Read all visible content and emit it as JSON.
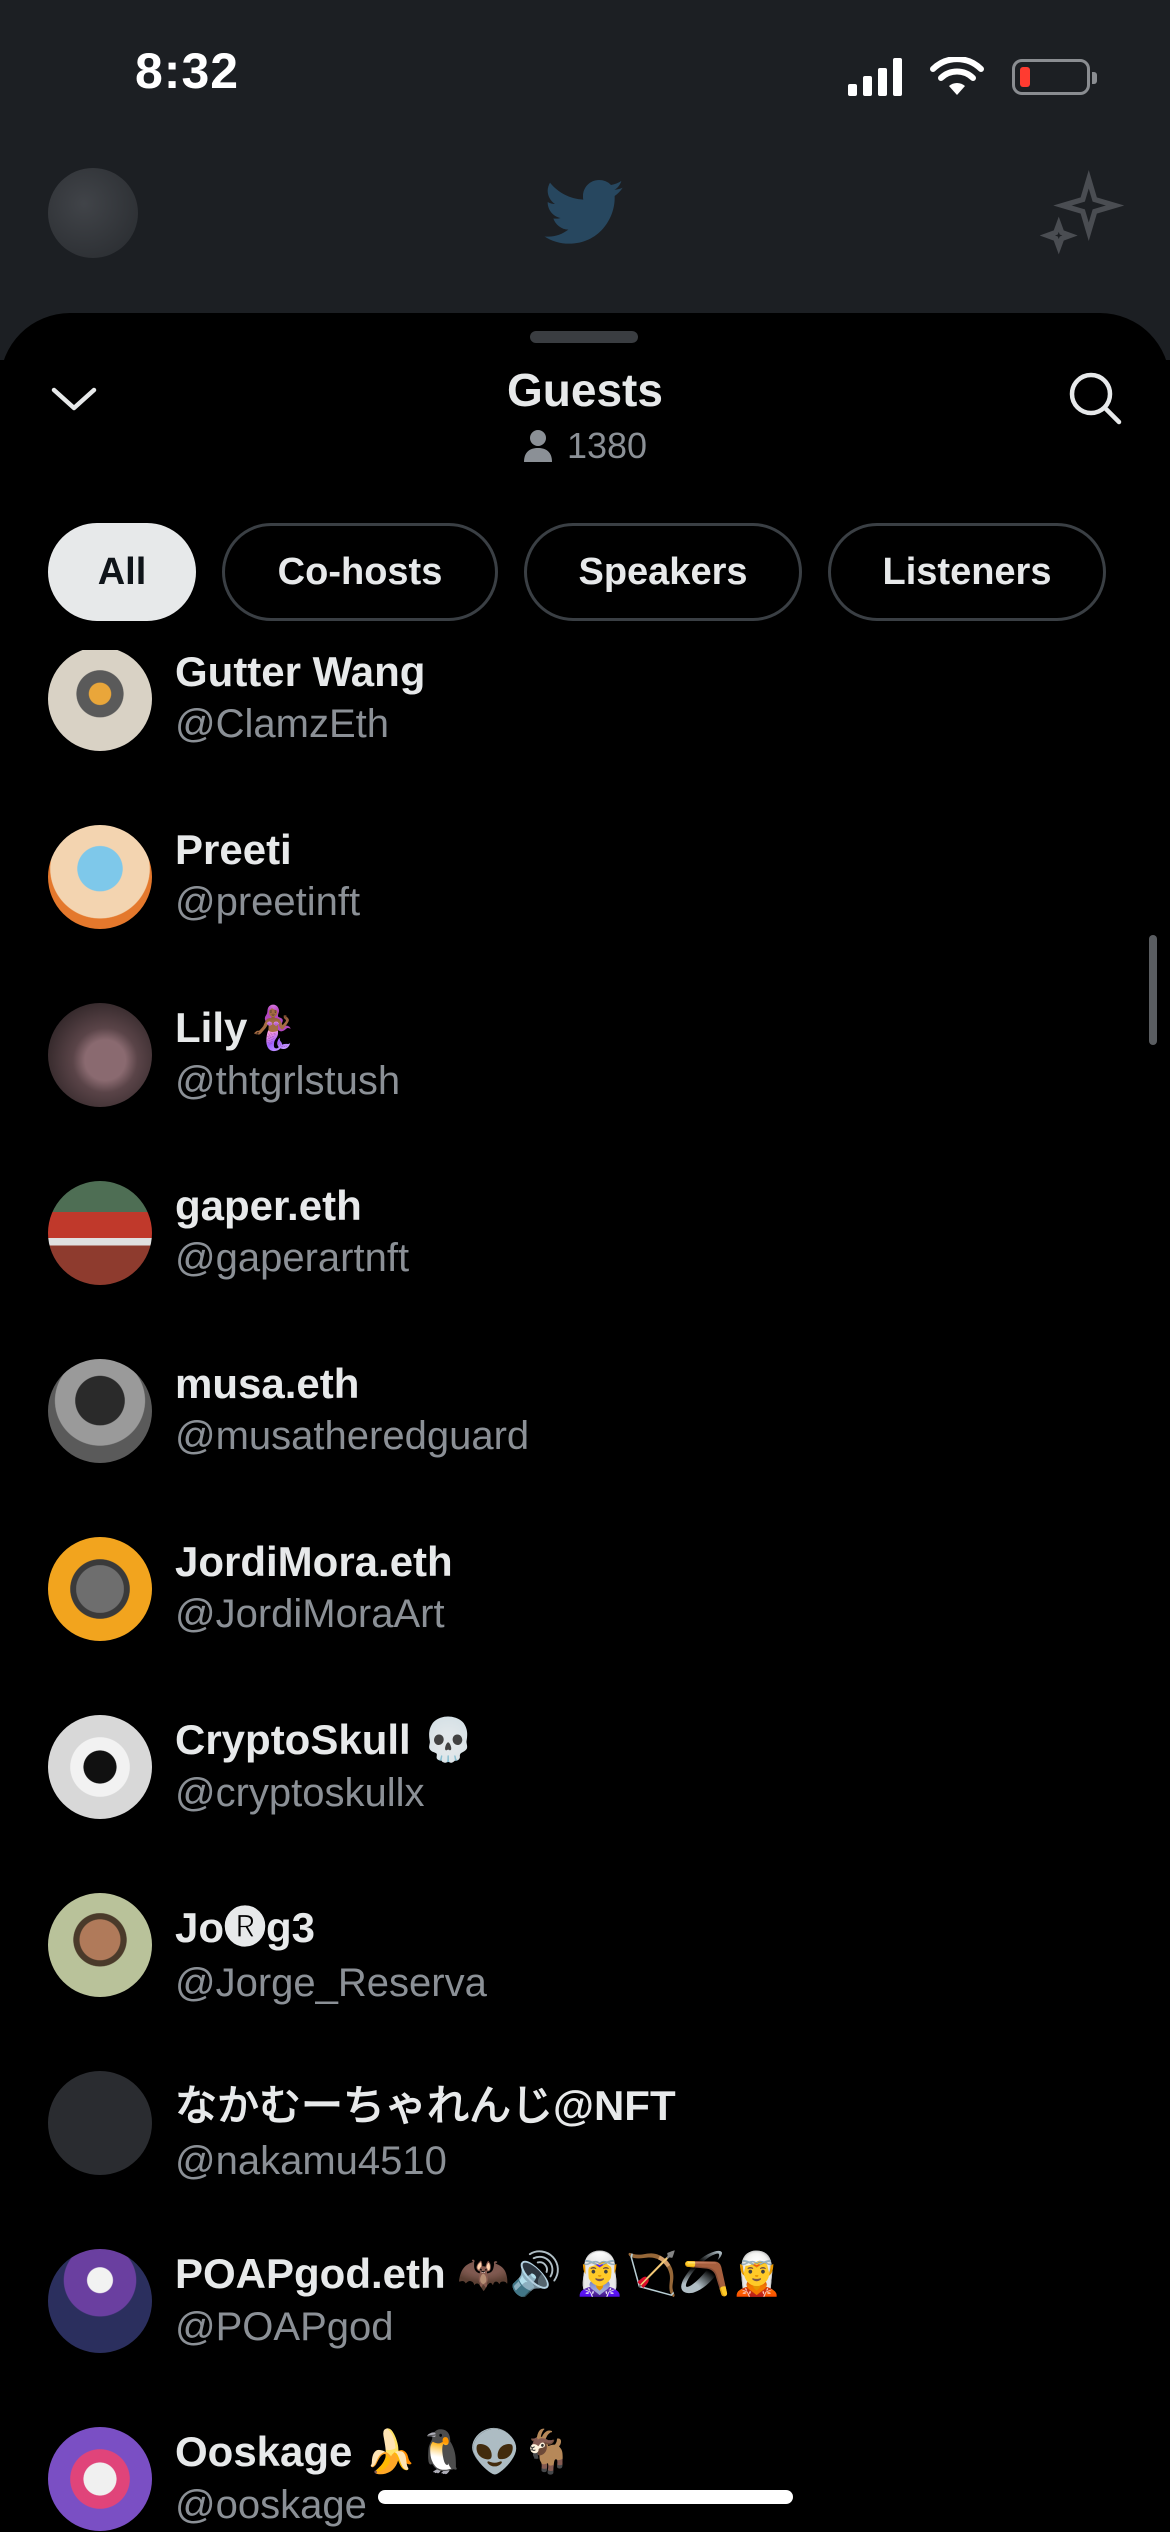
{
  "status_bar": {
    "time": "8:32"
  },
  "sheet": {
    "title": "Guests",
    "guest_count": "1380"
  },
  "tabs": [
    {
      "label": "All",
      "active": true
    },
    {
      "label": "Co-hosts",
      "active": false
    },
    {
      "label": "Speakers",
      "active": false
    },
    {
      "label": "Listeners",
      "active": false
    }
  ],
  "guests": [
    {
      "name": "Gutter Wang",
      "handle": "@ClamzEth",
      "avatar_color": "#d9d2c5"
    },
    {
      "name": "Preeti",
      "handle": "@preetinft",
      "avatar_color": "#f3d4b0"
    },
    {
      "name": "Lily🧜🏾‍♀️",
      "handle": "@thtgrlstush",
      "avatar_color": "#5a4448"
    },
    {
      "name": "gaper.eth",
      "handle": "@gaperartnft",
      "avatar_color": "#4e6e54"
    },
    {
      "name": "musa.eth",
      "handle": "@musatheredguard",
      "avatar_color": "#8f8f8f"
    },
    {
      "name": "JordiMora.eth",
      "handle": "@JordiMoraArt",
      "avatar_color": "#f2a41e"
    },
    {
      "name": "CryptoSkull 💀",
      "handle": "@cryptoskullx",
      "avatar_color": "#d8d8d8"
    },
    {
      "name": "Jo🅡g3",
      "handle": "@Jorge_Reserva",
      "avatar_color": "#b9c29a"
    },
    {
      "name": "なかむーちゃれんじ@NFT",
      "handle": "@nakamu4510",
      "avatar_color": "#2a2c30"
    },
    {
      "name": "POAPgod.eth 🦇🔊 🧝‍♀️🏹🪃🧝",
      "handle": "@POAPgod",
      "avatar_color": "#2b2f5e"
    },
    {
      "name": "Ooskage 🍌🐧👽🐐",
      "handle": "@ooskage",
      "avatar_color": "#7a4fc4"
    }
  ]
}
